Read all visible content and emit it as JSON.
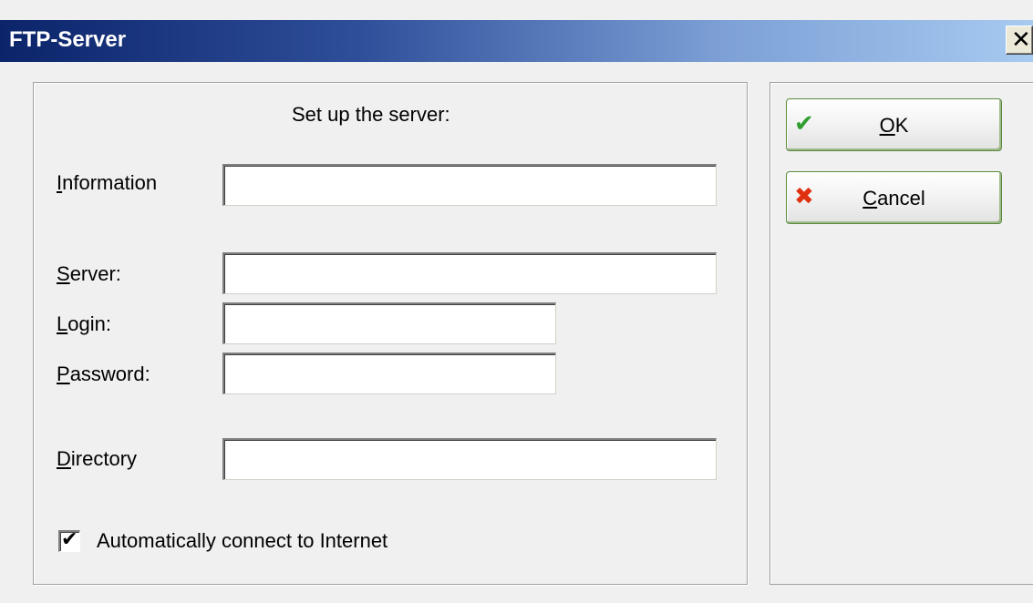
{
  "window": {
    "title": "FTP-Server",
    "close_glyph": "✕"
  },
  "form": {
    "heading": "Set up the server:",
    "fields": [
      {
        "id": "information",
        "label": "Information",
        "mnemonic": "I",
        "value": "",
        "placeholder": ""
      },
      {
        "id": "server",
        "label": "Server:",
        "mnemonic": "S",
        "value": "",
        "placeholder": ""
      },
      {
        "id": "login",
        "label": "Login:",
        "mnemonic": "L",
        "value": "",
        "placeholder": ""
      },
      {
        "id": "password",
        "label": "Password:",
        "mnemonic": "P",
        "value": "",
        "placeholder": ""
      },
      {
        "id": "directory",
        "label": "Directory",
        "mnemonic": "D",
        "value": "",
        "placeholder": ""
      }
    ],
    "auto_connect": {
      "label": "Automatically connect to Internet",
      "checked": true
    }
  },
  "buttons": {
    "ok": {
      "label": "OK",
      "mnemonic": "O",
      "icon": "checkmark-icon",
      "icon_color": "#2e9e2e"
    },
    "cancel": {
      "label": "Cancel",
      "mnemonic": "C",
      "icon": "cross-icon",
      "icon_color": "#e03010"
    }
  },
  "colors": {
    "title_gradient_start": "#0b246a",
    "title_gradient_end": "#a6caf0",
    "button_border": "#5a8a3c"
  }
}
